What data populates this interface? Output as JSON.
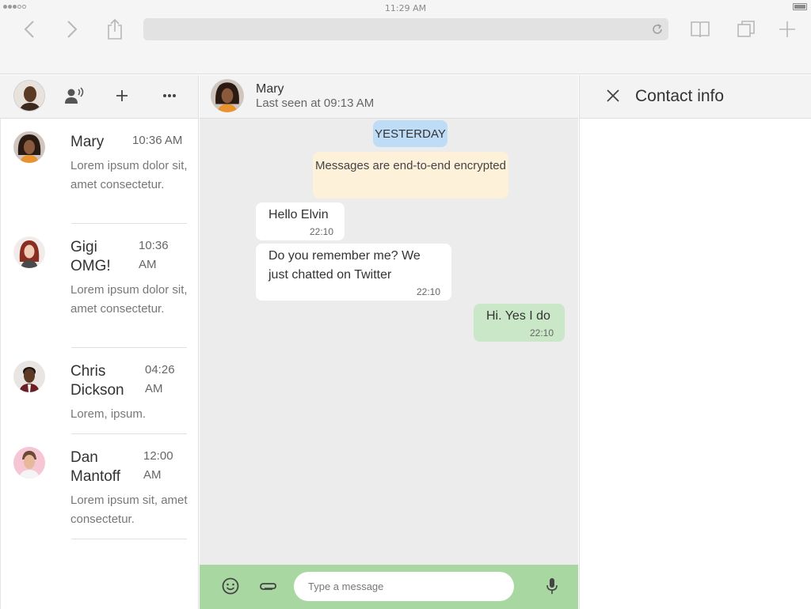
{
  "browser": {
    "clock": "11:29 AM"
  },
  "colors": {
    "day_pill": "#bfdcf6",
    "encryption_note": "#fdf1da",
    "outgoing_bubble": "#cae8c7",
    "composer_bar": "#a8d7a2",
    "panel_header": "#f3f3f3",
    "conversation_bg": "#ececec"
  },
  "chats": [
    {
      "name": "Mary",
      "time": "10:36 AM",
      "preview": "Lorem ipsum dolor sit, amet consectetur."
    },
    {
      "name": "Gigi OMG!",
      "time": "10:36 AM",
      "preview": "Lorem ipsum dolor sit, amet consectetur."
    },
    {
      "name": "Chris Dickson",
      "time": "04:26 AM",
      "preview": "Lorem, ipsum."
    },
    {
      "name": "Dan Mantoff",
      "time": "12:00 AM",
      "preview": "Lorem ipsum sit, amet consectetur."
    }
  ],
  "conversation": {
    "name": "Mary",
    "status": "Last seen at 09:13 AM",
    "day_label": "YESTERDAY",
    "encryption_note": "Messages are end-to-end encrypted",
    "messages": [
      {
        "direction": "in",
        "text": "Hello Elvin",
        "time": "22:10"
      },
      {
        "direction": "in",
        "text": "Do you remember me? We just chatted on Twitter",
        "time": "22:10"
      },
      {
        "direction": "out",
        "text": "Hi. Yes I do",
        "time": "22:10"
      }
    ],
    "input_placeholder": "Type a message"
  },
  "contact_info": {
    "title": "Contact info"
  }
}
